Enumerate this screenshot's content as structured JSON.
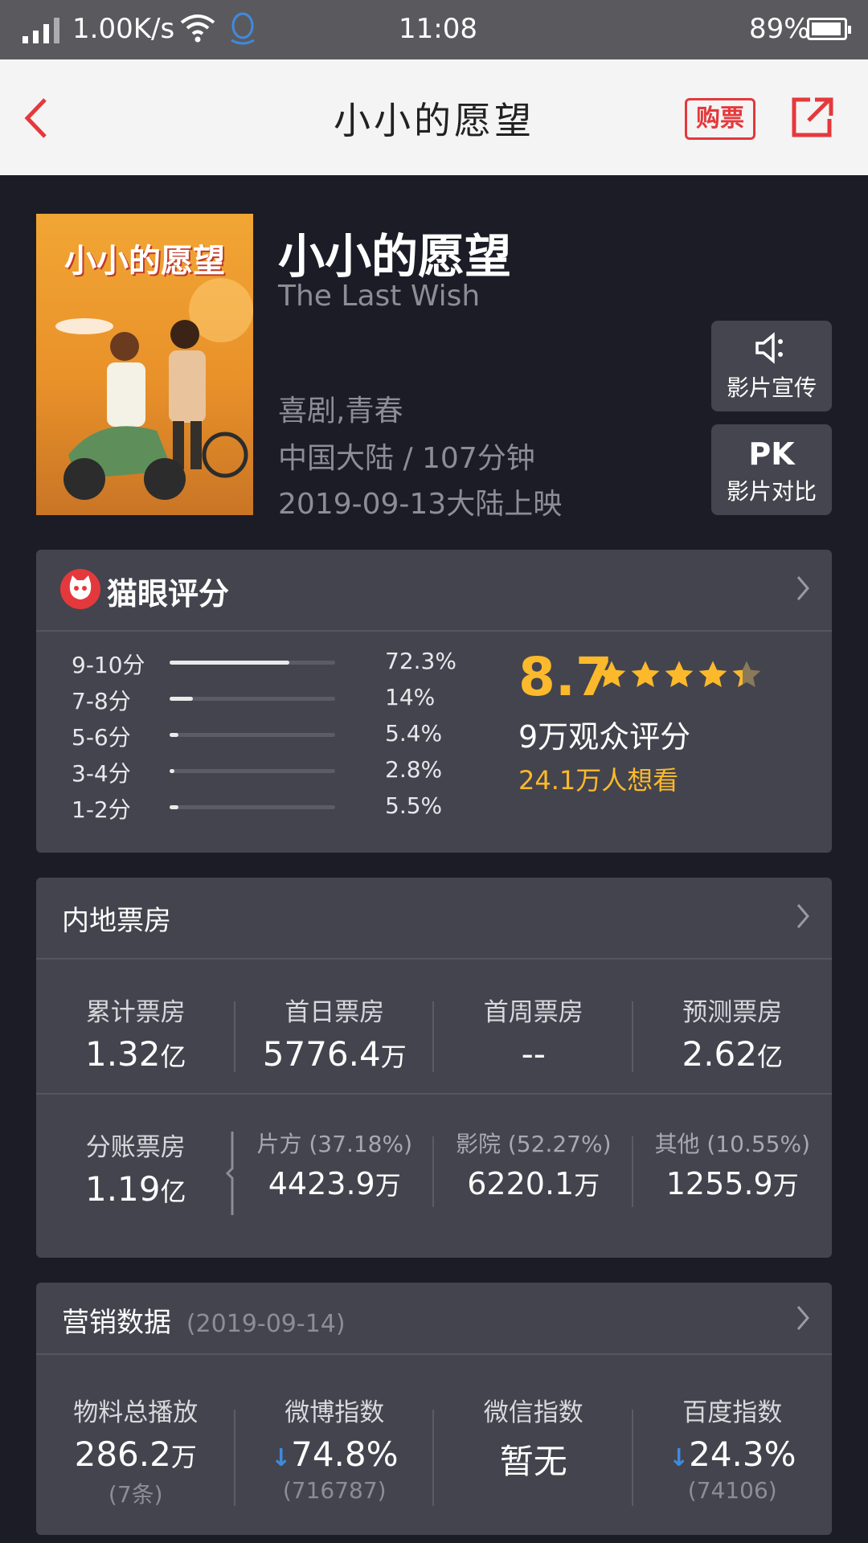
{
  "status": {
    "speed": "1.00K/s",
    "time": "11:08",
    "battery": "89%",
    "battery_level": 0.89
  },
  "nav": {
    "title": "小小的愿望",
    "buy_label": "购票"
  },
  "movie": {
    "title_cn": "小小的愿望",
    "title_en": "The Last Wish",
    "genre": "喜剧,青春",
    "region_duration": "中国大陆 / 107分钟",
    "release": "2019-09-13大陆上映",
    "poster_title": "小小的愿望"
  },
  "side_buttons": {
    "promo_label": "影片宣传",
    "pk_icon": "PK",
    "pk_label": "影片对比"
  },
  "rating": {
    "header": "猫眼评分",
    "score": "8.7",
    "stars": 4.35,
    "count": "9万观众评分",
    "want": "24.1万人想看",
    "distribution": [
      {
        "label": "9-10分",
        "pct": "72.3%",
        "value": 0.723
      },
      {
        "label": "7-8分",
        "pct": "14%",
        "value": 0.14
      },
      {
        "label": "5-6分",
        "pct": "5.4%",
        "value": 0.054
      },
      {
        "label": "3-4分",
        "pct": "2.8%",
        "value": 0.028
      },
      {
        "label": "1-2分",
        "pct": "5.5%",
        "value": 0.055
      }
    ]
  },
  "boxoffice": {
    "header": "内地票房",
    "row1": [
      {
        "label": "累计票房",
        "value": "1.32",
        "unit": "亿"
      },
      {
        "label": "首日票房",
        "value": "5776.4",
        "unit": "万"
      },
      {
        "label": "首周票房",
        "value": "--",
        "unit": ""
      },
      {
        "label": "预测票房",
        "value": "2.62",
        "unit": "亿"
      }
    ],
    "split": {
      "label": "分账票房",
      "value": "1.19",
      "unit": "亿"
    },
    "row2": [
      {
        "label": "片方 (37.18%)",
        "value": "4423.9",
        "unit": "万"
      },
      {
        "label": "影院 (52.27%)",
        "value": "6220.1",
        "unit": "万"
      },
      {
        "label": "其他 (10.55%)",
        "value": "1255.9",
        "unit": "万"
      }
    ]
  },
  "marketing": {
    "header": "营销数据",
    "date": "(2019-09-14)",
    "items": [
      {
        "label": "物料总播放",
        "value": "286.2",
        "unit": "万",
        "sub": "(7条)",
        "arrow": ""
      },
      {
        "label": "微博指数",
        "value": "74.8%",
        "unit": "",
        "sub": "(716787)",
        "arrow": "↓"
      },
      {
        "label": "微信指数",
        "value": "暂无",
        "unit": "",
        "sub": "",
        "arrow": ""
      },
      {
        "label": "百度指数",
        "value": "24.3%",
        "unit": "",
        "sub": "(74106)",
        "arrow": "↓"
      }
    ]
  },
  "colors": {
    "accent_red": "#e4393c",
    "gold": "#fbb92b",
    "arrow_blue": "#3f8ae0",
    "card_bg": "#44444e",
    "page_bg": "#1c1c27"
  }
}
